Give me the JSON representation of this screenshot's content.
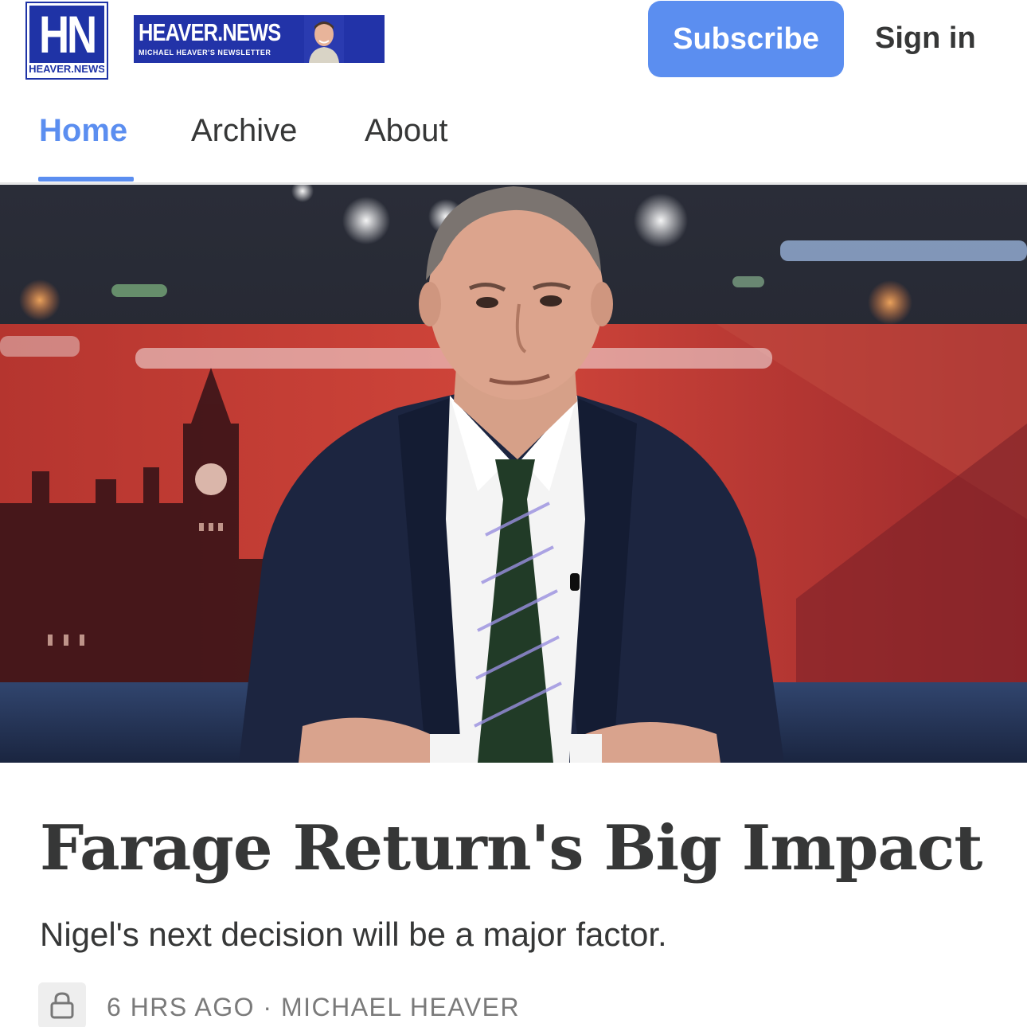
{
  "header": {
    "logo_letters": "HN",
    "logo_caption": "HEAVER.NEWS",
    "banner_title": "HEAVER.NEWS",
    "banner_subtitle": "MICHAEL HEAVER'S NEWSLETTER",
    "subscribe_label": "Subscribe",
    "signin_label": "Sign in"
  },
  "tabs": [
    {
      "label": "Home",
      "active": true
    },
    {
      "label": "Archive",
      "active": false
    },
    {
      "label": "About",
      "active": false
    }
  ],
  "article": {
    "title": "Farage Return's Big Impact",
    "subtitle": "Nigel's next decision will be a major factor.",
    "meta": {
      "time": "6 HRS AGO",
      "separator": "·",
      "author": "MICHAEL HEAVER",
      "lock_icon": "lock-icon"
    }
  },
  "colors": {
    "accent": "#5b8ef0",
    "banner_blue": "#2233a8",
    "text": "#363737",
    "meta_gray": "#7a7a7a"
  }
}
